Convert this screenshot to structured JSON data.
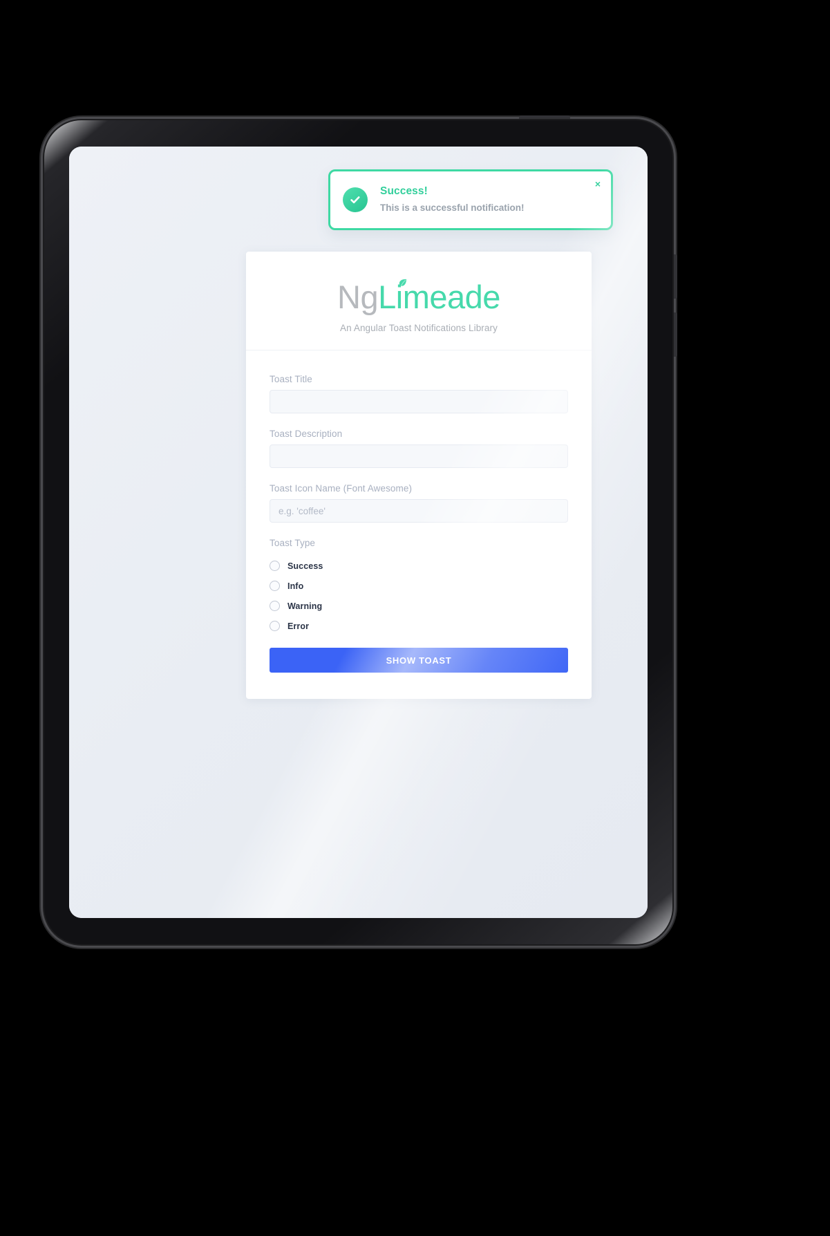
{
  "device": {
    "type": "tablet",
    "camera_icon": "camera-dot"
  },
  "toast": {
    "type": "success",
    "icon": "check-circle-icon",
    "title": "Success!",
    "message": "This is a successful notification!",
    "close_label": "×",
    "border_color": "#3ed9a3",
    "title_color": "#32cf9b",
    "icon_bg_color": "#27c491"
  },
  "card": {
    "logo": {
      "prefix": "Ng",
      "suffix": "Limeade",
      "prefix_color": "#b6b9bd",
      "suffix_color": "#46d9ab",
      "leaf_icon": "leaf-icon"
    },
    "tagline": "An Angular Toast Notifications Library",
    "fields": [
      {
        "name": "toast-title",
        "label": "Toast Title",
        "value": "",
        "placeholder": ""
      },
      {
        "name": "toast-description",
        "label": "Toast Description",
        "value": "",
        "placeholder": ""
      },
      {
        "name": "toast-icon-name",
        "label": "Toast Icon Name (Font Awesome)",
        "value": "",
        "placeholder": "e.g. 'coffee'"
      }
    ],
    "toast_type": {
      "label": "Toast Type",
      "selected": null,
      "options": [
        {
          "value": "success",
          "label": "Success",
          "checked": false
        },
        {
          "value": "info",
          "label": "Info",
          "checked": false
        },
        {
          "value": "warning",
          "label": "Warning",
          "checked": false
        },
        {
          "value": "error",
          "label": "Error",
          "checked": false
        }
      ]
    },
    "submit_button": {
      "label": "SHOW TOAST",
      "color": "#3b63f6"
    }
  }
}
